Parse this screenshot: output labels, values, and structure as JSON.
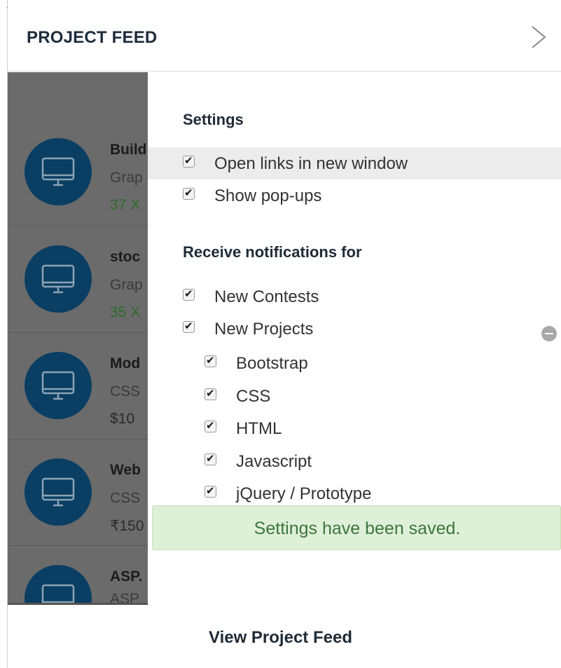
{
  "header": {
    "title": "PROJECT FEED",
    "next_icon": "chevron-right-icon"
  },
  "feed": {
    "items": [
      {
        "title": "Build",
        "subtitle": "Grap",
        "price": "37 X",
        "price_color": "#2e7d32",
        "icon": "monitor-icon"
      },
      {
        "title": "stoc",
        "subtitle": "Grap",
        "price": "35 X",
        "price_color": "#2e7d32",
        "icon": "monitor-icon"
      },
      {
        "title": "Mod",
        "subtitle": "CSS",
        "price": "$10",
        "price_color": "#2a2a2a",
        "icon": "monitor-icon"
      },
      {
        "title": "Web",
        "subtitle": "CSS",
        "price": "₹150",
        "price_color": "#2a2a2a",
        "icon": "monitor-icon"
      },
      {
        "title": "ASP.",
        "subtitle": "ASP",
        "price": "",
        "price_color": "#2a2a2a",
        "icon": "monitor-icon"
      }
    ]
  },
  "settings": {
    "title": "Settings",
    "options": [
      {
        "label": "Open links in new window",
        "checked": true
      },
      {
        "label": "Show pop-ups",
        "checked": true
      }
    ],
    "notifications_title": "Receive notifications for",
    "notifications": [
      {
        "label": "New Contests",
        "checked": true
      },
      {
        "label": "New Projects",
        "checked": true
      }
    ],
    "project_categories": [
      {
        "label": "Bootstrap",
        "checked": true
      },
      {
        "label": "CSS",
        "checked": true
      },
      {
        "label": "HTML",
        "checked": true
      },
      {
        "label": "Javascript",
        "checked": true
      },
      {
        "label": "jQuery / Prototype",
        "checked": true
      }
    ],
    "collapse_icon": "minus-circle-icon"
  },
  "toast": {
    "message": "Settings have been saved.",
    "color": "#3c763d",
    "background": "#dff0d8"
  },
  "footer": {
    "link_label": "View Project Feed"
  }
}
